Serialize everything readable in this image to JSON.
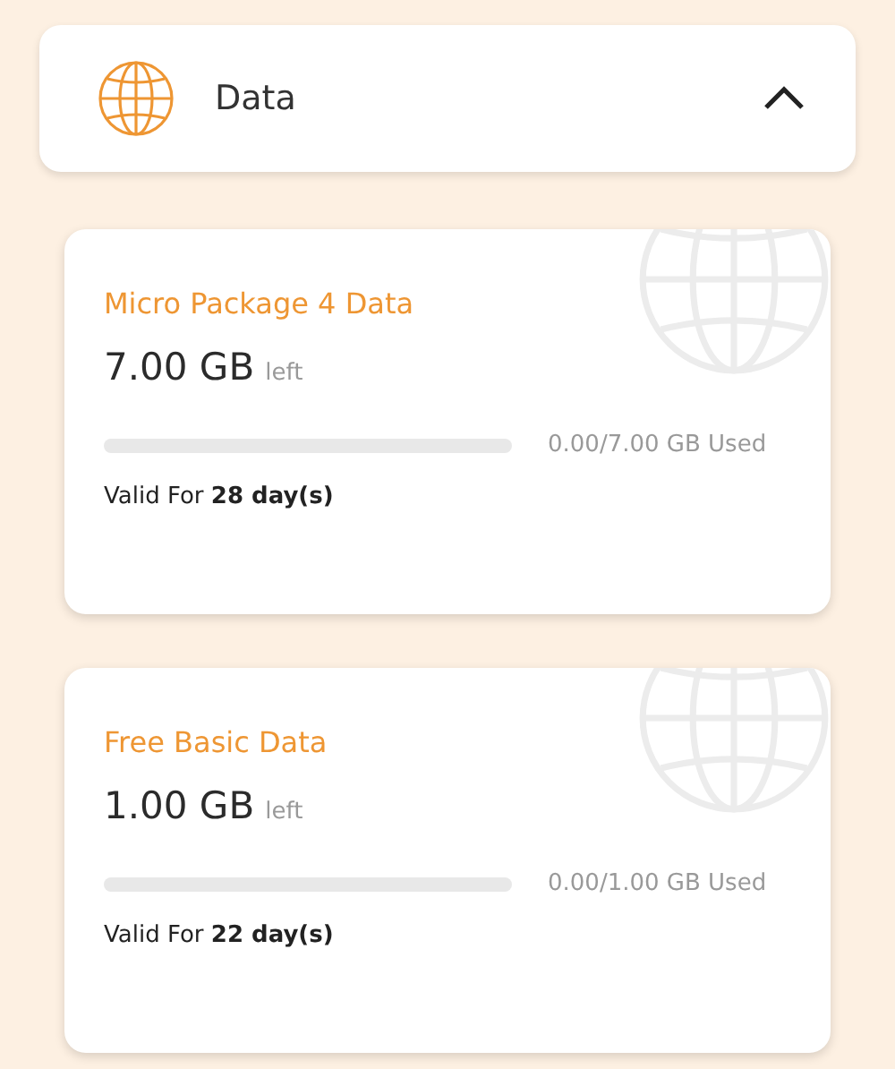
{
  "header": {
    "title": "Data",
    "expanded": true
  },
  "packages": [
    {
      "name": "Micro Package 4 Data",
      "remaining": "7.00 GB",
      "remaining_unit": "left",
      "level": 0,
      "usage": "0.00/7.00 GB Used",
      "validity": "Valid For **28 day(s)**"
    },
    {
      "name": "Free Basic Data",
      "remaining": "1.00 GB",
      "remaining_unit": "left",
      "level": 0,
      "usage": "0.00/1.00 GB Used",
      "validity": "Valid For **22 day(s)**"
    }
  ]
}
